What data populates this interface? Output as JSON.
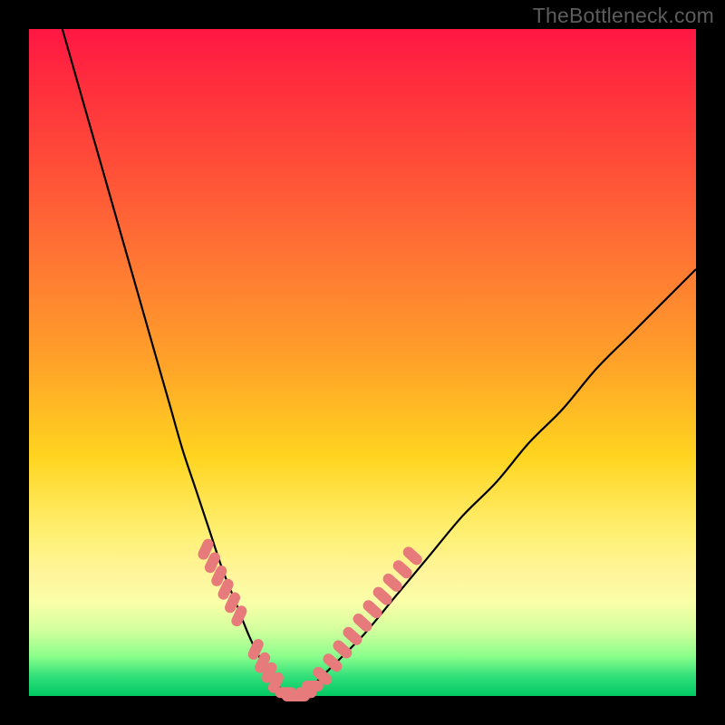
{
  "watermark": "TheBottleneck.com",
  "colors": {
    "background": "#000000",
    "curve": "#000000",
    "marker": "#e77a7a",
    "gradient_top": "#ff1744",
    "gradient_bottom": "#00c864"
  },
  "chart_data": {
    "type": "line",
    "title": "",
    "xlabel": "",
    "ylabel": "",
    "xlim": [
      0,
      100
    ],
    "ylim": [
      0,
      100
    ],
    "series": [
      {
        "name": "bottleneck-curve",
        "x": [
          5,
          7,
          9,
          11,
          13,
          15,
          17,
          19,
          21,
          23,
          25,
          27,
          29,
          31,
          33,
          35,
          37,
          39,
          41,
          43,
          45,
          50,
          55,
          60,
          65,
          70,
          75,
          80,
          85,
          90,
          95,
          100
        ],
        "y": [
          100,
          93,
          86,
          79,
          72,
          65,
          58,
          51,
          44,
          37,
          31,
          25,
          19,
          14,
          9,
          5,
          2,
          0,
          0,
          2,
          4,
          9,
          15,
          21,
          27,
          32,
          38,
          43,
          49,
          54,
          59,
          64
        ]
      }
    ],
    "marker_clusters": [
      {
        "name": "left-descent-markers",
        "points": [
          {
            "x": 26.5,
            "y": 22
          },
          {
            "x": 27.5,
            "y": 20
          },
          {
            "x": 28.5,
            "y": 18
          },
          {
            "x": 29.5,
            "y": 16
          },
          {
            "x": 30.5,
            "y": 14
          },
          {
            "x": 31.5,
            "y": 12
          }
        ]
      },
      {
        "name": "left-near-min-markers",
        "points": [
          {
            "x": 34,
            "y": 7
          },
          {
            "x": 35,
            "y": 5
          },
          {
            "x": 36,
            "y": 3.5
          },
          {
            "x": 37,
            "y": 2
          }
        ]
      },
      {
        "name": "valley-markers",
        "points": [
          {
            "x": 38.5,
            "y": 0.5
          },
          {
            "x": 39.5,
            "y": 0
          },
          {
            "x": 40.5,
            "y": 0
          },
          {
            "x": 41.5,
            "y": 0.5
          },
          {
            "x": 42.5,
            "y": 1.5
          }
        ]
      },
      {
        "name": "right-ascent-markers",
        "points": [
          {
            "x": 44,
            "y": 3
          },
          {
            "x": 45.5,
            "y": 5
          },
          {
            "x": 47,
            "y": 7
          },
          {
            "x": 48.5,
            "y": 9
          },
          {
            "x": 50,
            "y": 11
          },
          {
            "x": 51.5,
            "y": 13
          },
          {
            "x": 53,
            "y": 15
          },
          {
            "x": 54.5,
            "y": 17
          },
          {
            "x": 56,
            "y": 19
          },
          {
            "x": 57.5,
            "y": 21
          }
        ]
      }
    ]
  }
}
